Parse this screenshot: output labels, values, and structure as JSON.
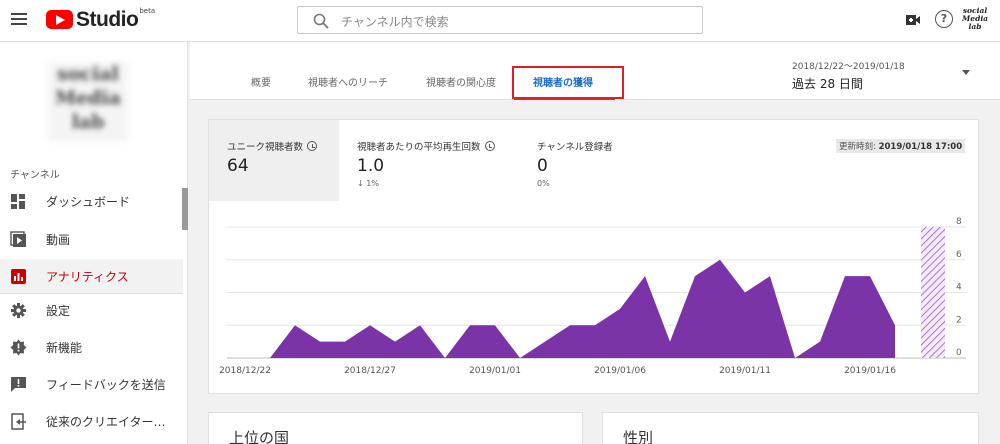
{
  "header": {
    "logo_text": "Studio",
    "logo_beta": "beta",
    "search_placeholder": "チャンネル内で検索",
    "avatar_text": [
      "social",
      "Media",
      "lab"
    ]
  },
  "sidebar": {
    "channel_name": [
      "social",
      "Media",
      "lab"
    ],
    "section_label": "チャンネル",
    "items": [
      {
        "label": "ダッシュボード",
        "icon": "dashboard-icon",
        "active": false
      },
      {
        "label": "動画",
        "icon": "video-icon",
        "active": false
      },
      {
        "label": "アナリティクス",
        "icon": "analytics-icon",
        "active": true
      },
      {
        "label": "設定",
        "icon": "settings-icon",
        "active": false
      },
      {
        "label": "新機能",
        "icon": "new-features-icon",
        "active": false
      },
      {
        "label": "フィードバックを送信",
        "icon": "feedback-icon",
        "active": false
      },
      {
        "label": "従来のクリエイター…",
        "icon": "classic-creator-icon",
        "active": false
      }
    ]
  },
  "tabs": [
    {
      "label": "概要",
      "active": false
    },
    {
      "label": "視聴者へのリーチ",
      "active": false
    },
    {
      "label": "視聴者の関心度",
      "active": false
    },
    {
      "label": "視聴者の獲得",
      "active": true
    }
  ],
  "date": {
    "range": "2018/12/22〜2019/01/18",
    "period": "過去 28 日間"
  },
  "metrics": [
    {
      "title": "ユニーク視聴者数",
      "value": "64",
      "change": ""
    },
    {
      "title": "視聴者あたりの平均再生回数",
      "value": "1.0",
      "change": "↓ 1%"
    },
    {
      "title": "チャンネル登録者",
      "value": "0",
      "change": "0%"
    }
  ],
  "updated": {
    "label": "更新時刻:",
    "time": "2019/01/18 17:00"
  },
  "chart_data": {
    "type": "area",
    "x": [
      "2018/12/22",
      "2018/12/23",
      "2018/12/24",
      "2018/12/25",
      "2018/12/26",
      "2018/12/27",
      "2018/12/28",
      "2018/12/29",
      "2018/12/30",
      "2018/12/31",
      "2019/01/01",
      "2019/01/02",
      "2019/01/03",
      "2019/01/04",
      "2019/01/05",
      "2019/01/06",
      "2019/01/07",
      "2019/01/08",
      "2019/01/09",
      "2019/01/10",
      "2019/01/11",
      "2019/01/12",
      "2019/01/13",
      "2019/01/14",
      "2019/01/15",
      "2019/01/16",
      "2019/01/17",
      "2019/01/18"
    ],
    "values": [
      0,
      0,
      2,
      1,
      1,
      2,
      1,
      2,
      0,
      2,
      2,
      0,
      1,
      2,
      2,
      3,
      5,
      1,
      5,
      6,
      4,
      5,
      0,
      1,
      5,
      5,
      2,
      5
    ],
    "partial_last_point": true,
    "x_tick_labels": [
      "2018/12/22",
      "2018/12/27",
      "2019/01/01",
      "2019/01/06",
      "2019/01/11",
      "2019/01/16"
    ],
    "y_tick_labels": [
      "0",
      "2",
      "4",
      "6",
      "8"
    ],
    "ylim": [
      0,
      8
    ],
    "y_axis_side": "right",
    "grid": true,
    "color": "#7b33a8"
  },
  "bottom_cards": [
    {
      "title": "上位の国"
    },
    {
      "title": "性別"
    }
  ],
  "colors": {
    "accent_blue": "#1a6fcf",
    "active_red": "#cc0000",
    "highlight_red": "#e01e26",
    "chart_purple": "#7b33a8"
  }
}
